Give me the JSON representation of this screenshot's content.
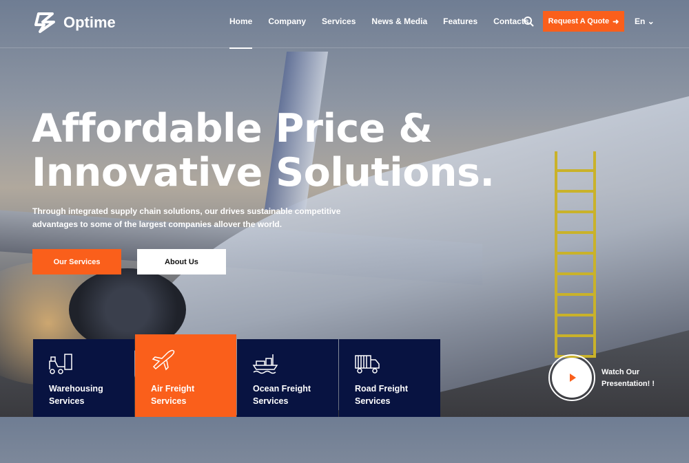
{
  "brand": {
    "name": "Optime",
    "accent": "#fa5f1b",
    "navy": "#081341"
  },
  "nav": {
    "items": [
      "Home",
      "Company",
      "Services",
      "News & Media",
      "Features",
      "Contacts"
    ],
    "active": "Home",
    "quote": "Request A Quote",
    "lang": "En"
  },
  "hero": {
    "title_line1": "Affordable Price &",
    "title_line2": "Innovative Solutions.",
    "subtitle": "Through integrated supply chain solutions, our drives sustainable competitive advantages to some of the largest companies allover the world.",
    "primary": "Our Services",
    "secondary": "About Us"
  },
  "services": [
    {
      "line1": "Warehousing",
      "line2": "Services",
      "icon": "forklift-icon"
    },
    {
      "line1": "Air Freight",
      "line2": "Services",
      "icon": "airplane-icon"
    },
    {
      "line1": "Ocean Freight",
      "line2": "Services",
      "icon": "ship-icon"
    },
    {
      "line1": "Road Freight",
      "line2": "Services",
      "icon": "truck-icon"
    }
  ],
  "video": {
    "line1": "Watch Our",
    "line2": "Presentation! !"
  }
}
